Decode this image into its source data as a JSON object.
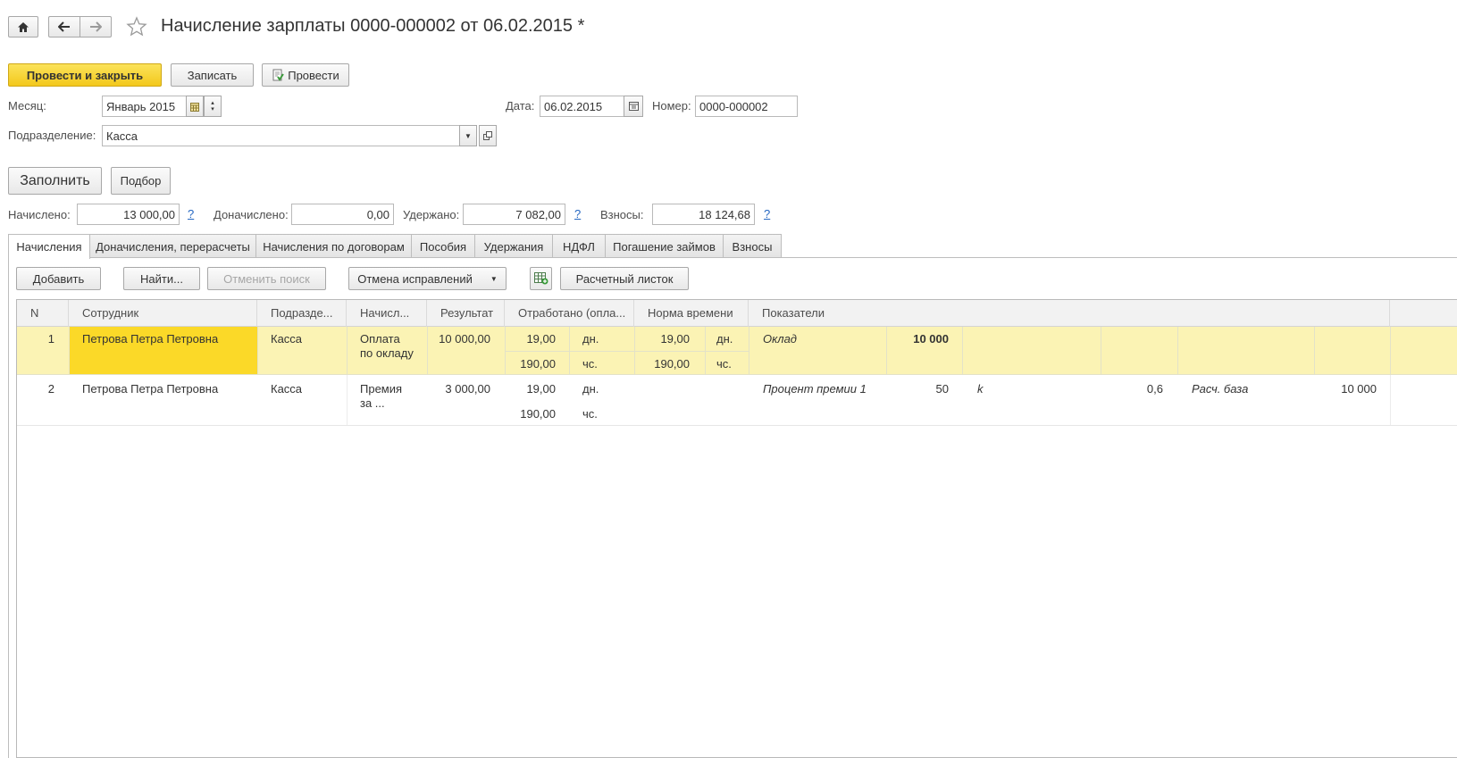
{
  "window": {
    "title": "Начисление зарплаты 0000-000002 от 06.02.2015 *",
    "icons": [
      "home-icon",
      "back-arrow-icon",
      "forward-arrow-icon",
      "star-icon"
    ]
  },
  "toolbar": {
    "post_close": "Провести и закрыть",
    "save": "Записать",
    "post": "Провести"
  },
  "form": {
    "month_label": "Месяц:",
    "month_value": "Январь 2015",
    "date_label": "Дата:",
    "date_value": "06.02.2015",
    "number_label": "Номер:",
    "number_value": "0000-000002",
    "dept_label": "Подразделение:",
    "dept_value": "Касса"
  },
  "actions": {
    "fill": "Заполнить",
    "select": "Подбор"
  },
  "totals": {
    "accrued_label": "Начислено:",
    "accrued_value": "13 000,00",
    "extra_label": "Доначислено:",
    "extra_value": "0,00",
    "withheld_label": "Удержано:",
    "withheld_value": "7 082,00",
    "contrib_label": "Взносы:",
    "contrib_value": "18 124,68",
    "help": "?"
  },
  "tabs": [
    "Начисления",
    "Доначисления, перерасчеты",
    "Начисления по договорам",
    "Пособия",
    "Удержания",
    "НДФЛ",
    "Погашение займов",
    "Взносы"
  ],
  "table_toolbar": {
    "add": "Добавить",
    "find": "Найти...",
    "cancel_search": "Отменить поиск",
    "cancel_fixes": "Отмена исправлений",
    "payslip": "Расчетный листок"
  },
  "table": {
    "headers": [
      "N",
      "Сотрудник",
      "Подразде...",
      "Начисл...",
      "Результат",
      "Отработано (опла...",
      "Норма времени",
      "Показатели"
    ],
    "rows": [
      {
        "n": "1",
        "employee": "Петрова Петра Петровна",
        "dept": "Касса",
        "accrual_l1": "Оплата",
        "accrual_l2": "по окладу",
        "result": "10 000,00",
        "worked_days": "19,00",
        "worked_days_unit": "дн.",
        "worked_hours": "190,00",
        "worked_hours_unit": "чс.",
        "norm_days": "19,00",
        "norm_days_unit": "дн.",
        "norm_hours": "190,00",
        "norm_hours_unit": "чс.",
        "ind1_name": "Оклад",
        "ind1_value": "10 000"
      },
      {
        "n": "2",
        "employee": "Петрова Петра Петровна",
        "dept": "Касса",
        "accrual_l1": "Премия",
        "accrual_l2": "за ...",
        "result": "3 000,00",
        "worked_days": "19,00",
        "worked_days_unit": "дн.",
        "worked_hours": "190,00",
        "worked_hours_unit": "чс.",
        "ind1_name": "Процент премии 1",
        "ind1_value": "50",
        "ind2_name": "k",
        "ind2_value": "0,6",
        "ind3_name": "Расч. база",
        "ind3_value": "10 000"
      }
    ]
  },
  "colors": {
    "primary_button": "#f5cd22",
    "selected_row": "#fbf3b4",
    "selected_cell": "#fbd928",
    "help_link": "#2567c1"
  }
}
